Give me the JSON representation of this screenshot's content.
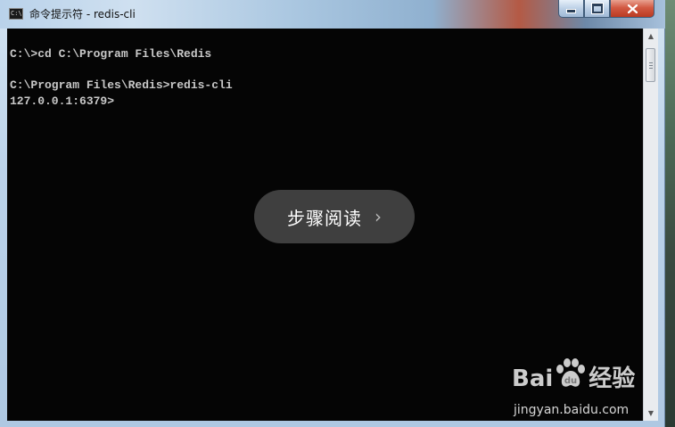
{
  "window": {
    "title": "命令提示符 - redis-cli",
    "icon_text": "C:\\"
  },
  "console": {
    "lines": [
      "C:\\>cd C:\\Program Files\\Redis",
      "",
      "C:\\Program Files\\Redis>redis-cli",
      "127.0.0.1:6379>"
    ]
  },
  "overlay": {
    "label": "步骤阅读",
    "chevron": "›"
  },
  "watermark": {
    "brand_left": "Bai",
    "brand_right": "经验",
    "url": "jingyan.baidu.com"
  },
  "icons": {
    "minimize": "minimize-icon",
    "maximize": "maximize-icon",
    "close": "close-icon"
  }
}
